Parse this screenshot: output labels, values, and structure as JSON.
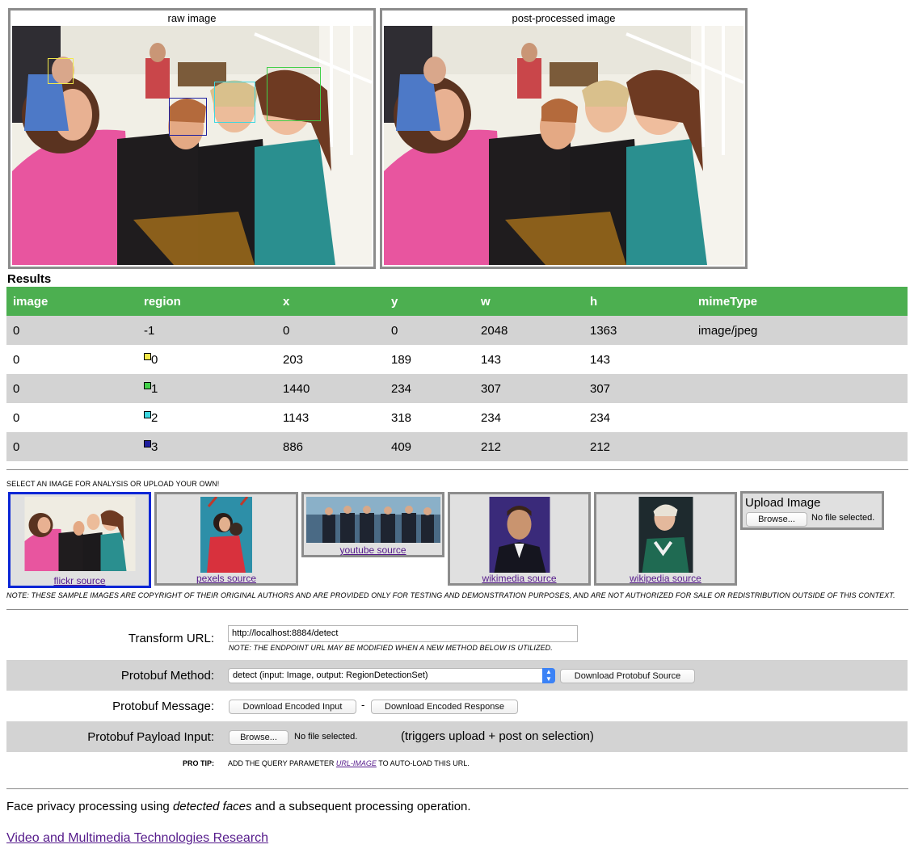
{
  "panels": {
    "raw_caption": "raw image",
    "post_caption": "post-processed image"
  },
  "colors": {
    "table_header": "#4caf50",
    "row_odd": "#d3d3d3",
    "face0": "#f2e84a",
    "face1": "#43d04a",
    "face2": "#3ed7e0",
    "face3": "#1f1f9e",
    "selected_border": "#0a26d6",
    "link": "#551a8b"
  },
  "results": {
    "title": "Results",
    "headers": [
      "image",
      "region",
      "x",
      "y",
      "w",
      "h",
      "mimeType"
    ],
    "rows": [
      {
        "image": "0",
        "region": "-1",
        "x": "0",
        "y": "0",
        "w": "2048",
        "h": "1363",
        "mime": "image/jpeg",
        "swatch": ""
      },
      {
        "image": "0",
        "region": "0",
        "x": "203",
        "y": "189",
        "w": "143",
        "h": "143",
        "mime": "",
        "swatch": "#f2e84a"
      },
      {
        "image": "0",
        "region": "1",
        "x": "1440",
        "y": "234",
        "w": "307",
        "h": "307",
        "mime": "",
        "swatch": "#43d04a"
      },
      {
        "image": "0",
        "region": "2",
        "x": "1143",
        "y": "318",
        "w": "234",
        "h": "234",
        "mime": "",
        "swatch": "#3ed7e0"
      },
      {
        "image": "0",
        "region": "3",
        "x": "886",
        "y": "409",
        "w": "212",
        "h": "212",
        "mime": "",
        "swatch": "#1f1f9e"
      }
    ]
  },
  "samples": {
    "heading": "SELECT AN IMAGE FOR ANALYSIS OR UPLOAD YOUR OWN!",
    "items": [
      {
        "label": "flickr source"
      },
      {
        "label": "pexels source"
      },
      {
        "label": "youtube source"
      },
      {
        "label": "wikimedia source"
      },
      {
        "label": "wikipedia source"
      }
    ],
    "upload_title": "Upload Image",
    "browse_label": "Browse...",
    "no_file": "No file selected.",
    "copyright_note": "NOTE: THESE SAMPLE IMAGES ARE COPYRIGHT OF THEIR ORIGINAL AUTHORS AND ARE PROVIDED ONLY FOR TESTING AND DEMONSTRATION PURPOSES, AND ARE NOT AUTHORIZED FOR SALE OR REDISTRIBUTION OUTSIDE OF THIS CONTEXT."
  },
  "form": {
    "transform_label": "Transform URL:",
    "transform_value": "http://localhost:8884/detect",
    "endpoint_note": "NOTE: THE ENDPOINT URL MAY BE MODIFIED WHEN A NEW METHOD BELOW IS UTILIZED.",
    "method_label": "Protobuf Method:",
    "method_value": "detect (input: Image, output: RegionDetectionSet)",
    "download_source": "Download Protobuf Source",
    "message_label": "Protobuf Message:",
    "download_input": "Download Encoded Input",
    "dash": "-",
    "download_response": "Download Encoded Response",
    "payload_label": "Protobuf Payload Input:",
    "browse_label": "Browse...",
    "no_file": "No file selected.",
    "payload_hint": "(triggers upload + post on selection)",
    "protip_label": "PRO TIP:",
    "protip_before": "ADD THE QUERY PARAMETER ",
    "protip_link": "URL-IMAGE",
    "protip_after": " TO AUTO-LOAD THIS URL."
  },
  "footer": {
    "desc_before": "Face privacy processing using ",
    "desc_em": "detected faces",
    "desc_after": " and a subsequent processing operation.",
    "link": "Video and Multimedia Technologies Research"
  }
}
